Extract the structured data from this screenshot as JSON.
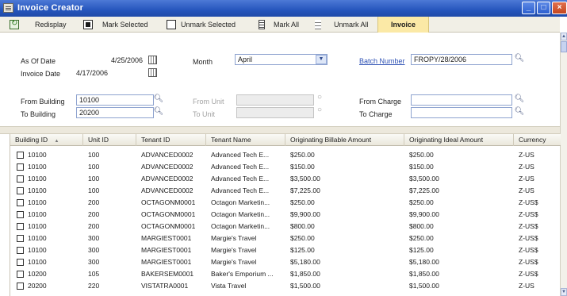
{
  "window": {
    "title": "Invoice Creator"
  },
  "toolbar": {
    "redisplay": "Redisplay",
    "mark_selected": "Mark Selected",
    "unmark_selected": "Unmark Selected",
    "mark_all": "Mark All",
    "unmark_all": "Unmark All",
    "invoice": "Invoice"
  },
  "form": {
    "as_of_date": {
      "label": "As Of Date",
      "value": "4/25/2006"
    },
    "invoice_date": {
      "label": "Invoice Date",
      "value": "4/17/2006"
    },
    "month": {
      "label": "Month",
      "value": "April"
    },
    "batch_number": {
      "label": "Batch Number",
      "value": "FROPY/28/2006"
    },
    "from_building": {
      "label": "From Building",
      "value": "10100"
    },
    "to_building": {
      "label": "To Building",
      "value": "20200"
    },
    "from_unit": {
      "label": "From Unit",
      "value": ""
    },
    "to_unit": {
      "label": "To Unit",
      "value": ""
    },
    "from_charge": {
      "label": "From Charge",
      "value": ""
    },
    "to_charge": {
      "label": "To Charge",
      "value": ""
    }
  },
  "grid": {
    "columns": [
      "Building ID",
      "Unit ID",
      "Tenant ID",
      "Tenant Name",
      "Originating Billable Amount",
      "Originating Ideal Amount",
      "Currency"
    ],
    "rows": [
      {
        "building": "10100",
        "unit": "100",
        "tenant_id": "ADVANCED0002",
        "name": "Advanced Tech E...",
        "billable": "$250.00",
        "ideal": "$250.00",
        "currency": "Z-US"
      },
      {
        "building": "10100",
        "unit": "100",
        "tenant_id": "ADVANCED0002",
        "name": "Advanced Tech E...",
        "billable": "$150.00",
        "ideal": "$150.00",
        "currency": "Z-US"
      },
      {
        "building": "10100",
        "unit": "100",
        "tenant_id": "ADVANCED0002",
        "name": "Advanced Tech E...",
        "billable": "$3,500.00",
        "ideal": "$3,500.00",
        "currency": "Z-US"
      },
      {
        "building": "10100",
        "unit": "100",
        "tenant_id": "ADVANCED0002",
        "name": "Advanced Tech E...",
        "billable": "$7,225.00",
        "ideal": "$7,225.00",
        "currency": "Z-US"
      },
      {
        "building": "10100",
        "unit": "200",
        "tenant_id": "OCTAGONM0001",
        "name": "Octagon Marketin...",
        "billable": "$250.00",
        "ideal": "$250.00",
        "currency": "Z-US$"
      },
      {
        "building": "10100",
        "unit": "200",
        "tenant_id": "OCTAGONM0001",
        "name": "Octagon Marketin...",
        "billable": "$9,900.00",
        "ideal": "$9,900.00",
        "currency": "Z-US$"
      },
      {
        "building": "10100",
        "unit": "200",
        "tenant_id": "OCTAGONM0001",
        "name": "Octagon Marketin...",
        "billable": "$800.00",
        "ideal": "$800.00",
        "currency": "Z-US$"
      },
      {
        "building": "10100",
        "unit": "300",
        "tenant_id": "MARGIEST0001",
        "name": "Margie's Travel",
        "billable": "$250.00",
        "ideal": "$250.00",
        "currency": "Z-US$"
      },
      {
        "building": "10100",
        "unit": "300",
        "tenant_id": "MARGIEST0001",
        "name": "Margie's Travel",
        "billable": "$125.00",
        "ideal": "$125.00",
        "currency": "Z-US$"
      },
      {
        "building": "10100",
        "unit": "300",
        "tenant_id": "MARGIEST0001",
        "name": "Margie's Travel",
        "billable": "$5,180.00",
        "ideal": "$5,180.00",
        "currency": "Z-US$"
      },
      {
        "building": "10200",
        "unit": "105",
        "tenant_id": "BAKERSEM0001",
        "name": "Baker's Emporium ...",
        "billable": "$1,850.00",
        "ideal": "$1,850.00",
        "currency": "Z-US$"
      },
      {
        "building": "20200",
        "unit": "220",
        "tenant_id": "VISTATRA0001",
        "name": "Vista Travel",
        "billable": "$1,500.00",
        "ideal": "$1,500.00",
        "currency": "Z-US"
      }
    ]
  }
}
